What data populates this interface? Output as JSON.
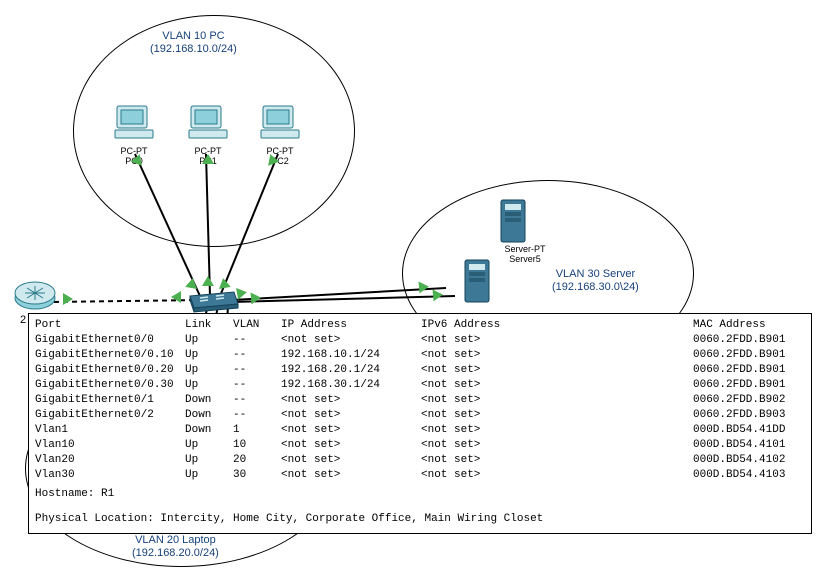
{
  "groups": {
    "vlan10": {
      "title": "VLAN 10 PC",
      "subnet": "(192.168.10.0/24)"
    },
    "vlan20": {
      "title": "VLAN 20 Laptop",
      "subnet": "(192.168.20.0/24)"
    },
    "vlan30": {
      "title": "VLAN 30 Server",
      "subnet": "(192.168.30.0\\24)"
    }
  },
  "nodes": {
    "pc0": {
      "line1": "PC-PT",
      "line2": "PC0"
    },
    "pc1": {
      "line1": "PC-PT",
      "line2": "PC1"
    },
    "pc2": {
      "line1": "PC-PT",
      "line2": "PC2"
    },
    "server": {
      "line1": "Server-PT",
      "line2": "Server5"
    },
    "router_left_num": "2"
  },
  "table": {
    "headers": {
      "port": "Port",
      "link": "Link",
      "vlan": "VLAN",
      "ip": "IP Address",
      "ipv6": "IPv6 Address",
      "mac": "MAC Address"
    },
    "rows": [
      {
        "port": "GigabitEthernet0/0",
        "link": "Up",
        "vlan": "--",
        "ip": "<not set>",
        "ipv6": "<not set>",
        "mac": "0060.2FDD.B901"
      },
      {
        "port": "GigabitEthernet0/0.10",
        "link": "Up",
        "vlan": "--",
        "ip": "192.168.10.1/24",
        "ipv6": "<not set>",
        "mac": "0060.2FDD.B901"
      },
      {
        "port": "GigabitEthernet0/0.20",
        "link": "Up",
        "vlan": "--",
        "ip": "192.168.20.1/24",
        "ipv6": "<not set>",
        "mac": "0060.2FDD.B901"
      },
      {
        "port": "GigabitEthernet0/0.30",
        "link": "Up",
        "vlan": "--",
        "ip": "192.168.30.1/24",
        "ipv6": "<not set>",
        "mac": "0060.2FDD.B901"
      },
      {
        "port": "GigabitEthernet0/1",
        "link": "Down",
        "vlan": "--",
        "ip": "<not set>",
        "ipv6": "<not set>",
        "mac": "0060.2FDD.B902"
      },
      {
        "port": "GigabitEthernet0/2",
        "link": "Down",
        "vlan": "--",
        "ip": "<not set>",
        "ipv6": "<not set>",
        "mac": "0060.2FDD.B903"
      },
      {
        "port": "Vlan1",
        "link": "Down",
        "vlan": "1",
        "ip": "<not set>",
        "ipv6": "<not set>",
        "mac": "000D.BD54.41DD"
      },
      {
        "port": "Vlan10",
        "link": "Up",
        "vlan": "10",
        "ip": "<not set>",
        "ipv6": "<not set>",
        "mac": "000D.BD54.4101"
      },
      {
        "port": "Vlan20",
        "link": "Up",
        "vlan": "20",
        "ip": "<not set>",
        "ipv6": "<not set>",
        "mac": "000D.BD54.4102"
      },
      {
        "port": "Vlan30",
        "link": "Up",
        "vlan": "30",
        "ip": "<not set>",
        "ipv6": "<not set>",
        "mac": "000D.BD54.4103"
      }
    ],
    "hostname_line": "Hostname: R1",
    "location_line": "Physical Location: Intercity, Home City, Corporate Office, Main Wiring Closet"
  }
}
